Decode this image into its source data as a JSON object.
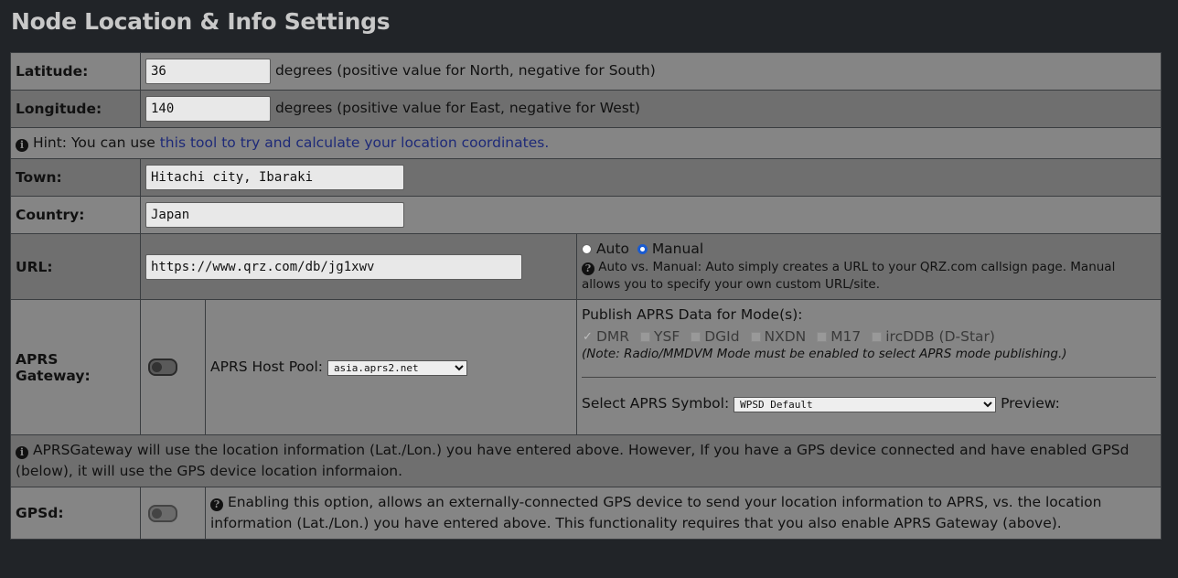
{
  "page_title": "Node Location & Info Settings",
  "latitude": {
    "label": "Latitude:",
    "value": "36",
    "help": "degrees (positive value for North, negative for South)"
  },
  "longitude": {
    "label": "Longitude:",
    "value": "140",
    "help": "degrees (positive value for East, negative for West)"
  },
  "hint": {
    "icon": "info-circle-icon",
    "prefix": "Hint: You can use ",
    "link": "this tool to try and calculate your location coordinates."
  },
  "town": {
    "label": "Town:",
    "value": "Hitachi city, Ibaraki"
  },
  "country": {
    "label": "Country:",
    "value": "Japan"
  },
  "url": {
    "label": "URL:",
    "value": "https://www.qrz.com/db/jg1xwv",
    "auto_label": "Auto",
    "manual_label": "Manual",
    "selected": "Manual",
    "help": "Auto vs. Manual: Auto simply creates a URL to your QRZ.com callsign page. Manual allows you to specify your own custom URL/site."
  },
  "aprs": {
    "label": "APRS Gateway:",
    "enabled": false,
    "host_pool_label": "APRS Host Pool:",
    "host_pool_value": "asia.aprs2.net",
    "publish_label": "Publish APRS Data for Mode(s):",
    "modes": [
      {
        "label": "DMR",
        "checked": true
      },
      {
        "label": "YSF",
        "checked": false
      },
      {
        "label": "DGId",
        "checked": false
      },
      {
        "label": "NXDN",
        "checked": false
      },
      {
        "label": "M17",
        "checked": false
      },
      {
        "label": "ircDDB (D-Star)",
        "checked": false
      }
    ],
    "modes_note": "(Note: Radio/MMDVM Mode must be enabled to select APRS mode publishing.)",
    "symbol_label": "Select APRS Symbol:",
    "symbol_value": "WPSD Default",
    "preview_label": "Preview:"
  },
  "aprs_info": "APRSGateway will use the location information (Lat./Lon.) you have entered above. However, If you have a GPS device connected and have enabled GPSd (below), it will use the GPS device location informaion.",
  "gpsd": {
    "label": "GPSd:",
    "enabled": false,
    "help": "Enabling this option, allows an externally-connected GPS device to send your location information to APRS, vs. the location information (Lat./Lon.) you have entered above. This functionality requires that you also enable APRS Gateway (above)."
  }
}
